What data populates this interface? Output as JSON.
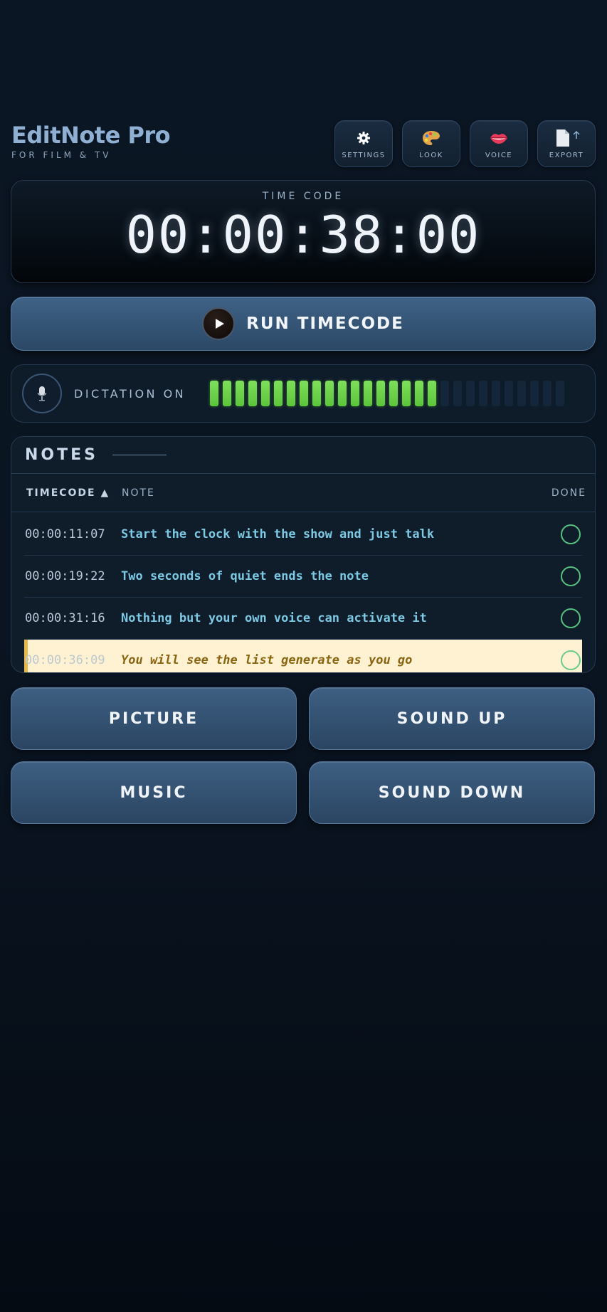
{
  "brand": {
    "title": "EditNote Pro",
    "subtitle": "FOR FILM & TV"
  },
  "toolbar": [
    {
      "label": "SETTINGS",
      "icon": "gear-icon"
    },
    {
      "label": "LOOK",
      "icon": "palette-icon"
    },
    {
      "label": "VOICE",
      "icon": "lips-icon"
    },
    {
      "label": "EXPORT",
      "icon": "document-export-icon"
    }
  ],
  "timecode": {
    "label": "TIME CODE",
    "value": "00:00:38:00"
  },
  "run_button": {
    "label": "RUN TIMECODE"
  },
  "dictation": {
    "label": "DICTATION ON",
    "level_fraction": 0.64,
    "segments_total": 28,
    "segments_on": 18
  },
  "notes": {
    "title": "NOTES",
    "columns": {
      "timecode": "TIMECODE ▲",
      "note": "NOTE",
      "done": "DONE"
    },
    "rows": [
      {
        "tc": "00:00:11:07",
        "text": "Start the clock with the show and just talk",
        "done": false
      },
      {
        "tc": "00:00:19:22",
        "text": "Two seconds of quiet ends the note",
        "done": false
      },
      {
        "tc": "00:00:31:16",
        "text": "Nothing but your own voice can activate it",
        "done": false
      },
      {
        "tc": "00:00:36:09",
        "text": "You will see the list generate as you go",
        "done": false,
        "active": true
      }
    ]
  },
  "categories": [
    "PICTURE",
    "SOUND UP",
    "MUSIC",
    "SOUND DOWN"
  ],
  "colors": {
    "meter_on": "#6fd84a",
    "check": "#57c27d",
    "active_row": "#fef2d3",
    "accent_bar": "#e6b84a"
  }
}
